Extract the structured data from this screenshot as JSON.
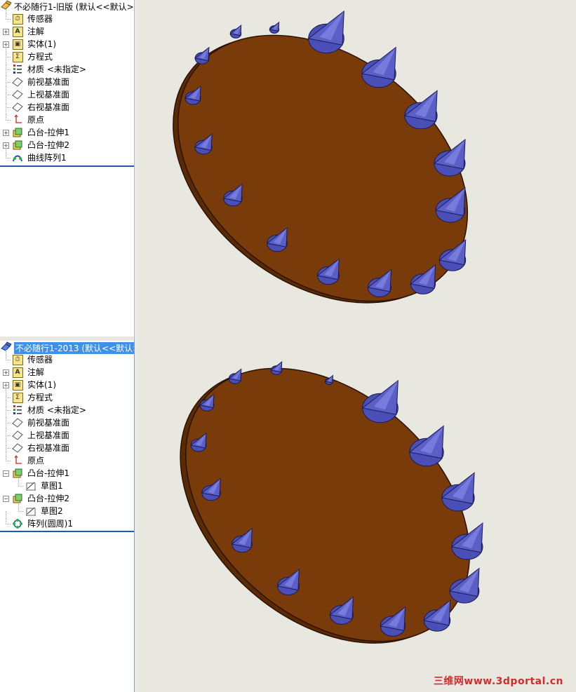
{
  "feature_tree_top": {
    "title": "不必随行1-旧版 (默认<<默认>",
    "items": [
      {
        "label": "传感器",
        "icon": "sensor-icon"
      },
      {
        "label": "注解",
        "icon": "annotation-icon"
      },
      {
        "label": "实体(1)",
        "icon": "solid-body-icon"
      },
      {
        "label": "方程式",
        "icon": "equation-icon"
      },
      {
        "label": "材质 <未指定>",
        "icon": "material-icon"
      },
      {
        "label": "前视基准面",
        "icon": "plane-icon"
      },
      {
        "label": "上视基准面",
        "icon": "plane-icon"
      },
      {
        "label": "右视基准面",
        "icon": "plane-icon"
      },
      {
        "label": "原点",
        "icon": "origin-icon"
      },
      {
        "label": "凸台-拉伸1",
        "icon": "boss-extrude-icon"
      },
      {
        "label": "凸台-拉伸2",
        "icon": "boss-extrude-icon"
      },
      {
        "label": "曲线阵列1",
        "icon": "curve-pattern-icon"
      }
    ]
  },
  "feature_tree_bottom": {
    "title": "不必随行1-2013 (默认<<默认>",
    "items": [
      {
        "label": "传感器",
        "icon": "sensor-icon"
      },
      {
        "label": "注解",
        "icon": "annotation-icon"
      },
      {
        "label": "实体(1)",
        "icon": "solid-body-icon"
      },
      {
        "label": "方程式",
        "icon": "equation-icon"
      },
      {
        "label": "材质 <未指定>",
        "icon": "material-icon"
      },
      {
        "label": "前视基准面",
        "icon": "plane-icon"
      },
      {
        "label": "上视基准面",
        "icon": "plane-icon"
      },
      {
        "label": "右视基准面",
        "icon": "plane-icon"
      },
      {
        "label": "原点",
        "icon": "origin-icon"
      },
      {
        "label": "凸台-拉伸1",
        "icon": "boss-extrude-icon"
      },
      {
        "label": "草图1",
        "icon": "sketch-icon"
      },
      {
        "label": "凸台-拉伸2",
        "icon": "boss-extrude-icon"
      },
      {
        "label": "草图2",
        "icon": "sketch-icon"
      },
      {
        "label": "阵列(圆周)1",
        "icon": "circular-pattern-icon"
      }
    ]
  },
  "viewport": {
    "watermark": "三维网www.3dportal.cn",
    "colors": {
      "disk": "#7a3b0b",
      "disk_edge": "#5a2a05",
      "cone": "#5a5fc8",
      "background": "#e8e7e0"
    }
  }
}
